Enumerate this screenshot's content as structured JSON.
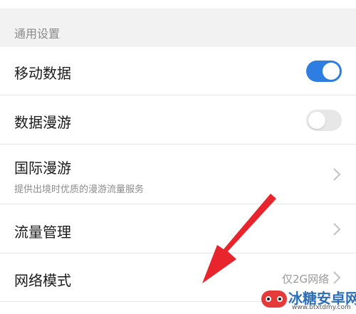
{
  "section": {
    "title": "通用设置"
  },
  "settings": [
    {
      "label": "移动数据",
      "control": "toggle",
      "state": "on"
    },
    {
      "label": "数据漫游",
      "control": "toggle",
      "state": "off"
    },
    {
      "label": "国际漫游",
      "subtitle": "提供出境时优质的漫游流量服务",
      "control": "chevron"
    },
    {
      "label": "流量管理",
      "control": "chevron"
    },
    {
      "label": "网络模式",
      "value": "仅2G网络",
      "control": "chevron"
    }
  ],
  "colors": {
    "toggle_on": "#2e7de1",
    "toggle_off": "#e7e7e7",
    "annotation_arrow": "#e8242c"
  },
  "watermark": {
    "name": "冰糖安卓网",
    "url": "www.btxtdmy.com"
  }
}
